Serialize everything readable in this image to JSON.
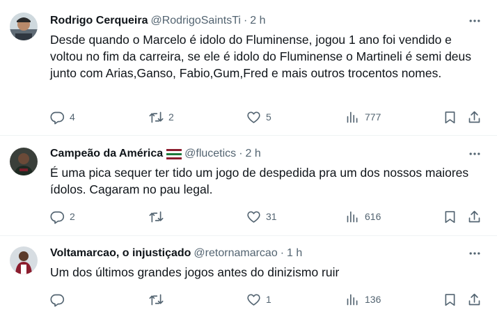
{
  "tweets": [
    {
      "name": "Rodrigo Cerqueira",
      "handle": "@RodrigoSaintsTi",
      "sep": "·",
      "time": "2 h",
      "text": "Desde quando o Marcelo é idolo do Fluminense, jogou 1 ano foi vendido e voltou no fim da carreira, se ele é idolo do Fluminense o Martineli é semi deus junto com Arias,Ganso, Fabio,Gum,Fred e mais outros trocentos nomes.",
      "replies": "4",
      "reposts": "2",
      "likes": "5",
      "views": "777"
    },
    {
      "name": "Campeão da América",
      "handle": "@flucetics",
      "sep": "·",
      "time": "2 h",
      "text": "É uma pica sequer ter tido um jogo de despedida pra um dos nossos maiores ídolos. Cagaram no pau legal.",
      "replies": "2",
      "reposts": "",
      "likes": "31",
      "views": "616"
    },
    {
      "name": "Voltamarcao, o injustiçado",
      "handle": "@retornamarcao",
      "sep": "·",
      "time": "1 h",
      "text": "Um dos últimos grandes jogos antes do dinizismo ruir",
      "replies": "",
      "reposts": "",
      "likes": "1",
      "views": "136"
    }
  ],
  "icons": {
    "reply": "reply-icon",
    "repost": "repost-icon",
    "like": "like-icon",
    "views": "views-icon",
    "bookmark": "bookmark-icon",
    "share": "share-icon",
    "more": "more-icon",
    "flag": "fluminense-flag-icon"
  },
  "colors": {
    "text": "#0f1419",
    "secondary": "#536471",
    "divider": "#eff3f4",
    "flag_green": "#1b7a3a",
    "flag_maroon": "#8c1d2e"
  }
}
